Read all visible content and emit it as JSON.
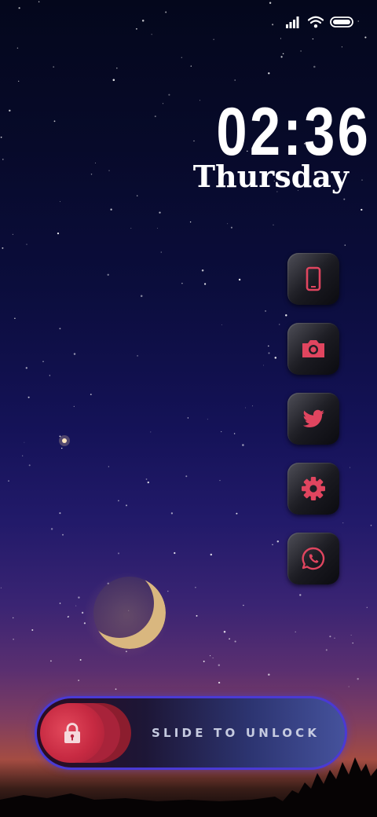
{
  "status_bar": {
    "signal_icon": "signal-bars-icon",
    "wifi_icon": "wifi-icon",
    "battery_icon": "battery-icon"
  },
  "clock": {
    "time": "02:36",
    "day": "Thursday"
  },
  "dock": {
    "apps": [
      {
        "name": "phone",
        "icon": "smartphone-icon"
      },
      {
        "name": "camera",
        "icon": "camera-icon"
      },
      {
        "name": "twitter",
        "icon": "twitter-bird-icon"
      },
      {
        "name": "settings",
        "icon": "gear-icon"
      },
      {
        "name": "whatsapp",
        "icon": "whatsapp-icon"
      }
    ],
    "accent_color": "#e0455f"
  },
  "unlock": {
    "label": "SLIDE TO UNLOCK",
    "knob_icon": "lock-icon",
    "knob_color": "#d9344f",
    "border_color": "#4a3ad4"
  }
}
